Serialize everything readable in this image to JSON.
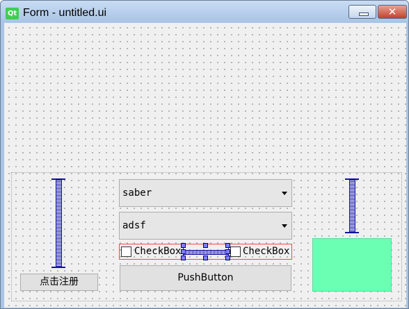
{
  "window": {
    "title": "Form - untitled.ui",
    "app_icon_text": "Qt",
    "minimize_glyph": "",
    "close_glyph": "✕"
  },
  "form": {
    "register_button": "点击注册",
    "combo1": {
      "value": "saber"
    },
    "combo2": {
      "value": "adsf"
    },
    "checkbox1": {
      "label": "CheckBox",
      "checked": false
    },
    "checkbox2": {
      "label": "CheckBox",
      "checked": false
    },
    "push_button": "PushButton",
    "frame_color": "#6affb2"
  },
  "colors": {
    "spacer": "#1414a0",
    "selection_border": "#ff4444",
    "handle": "#8080ff"
  }
}
